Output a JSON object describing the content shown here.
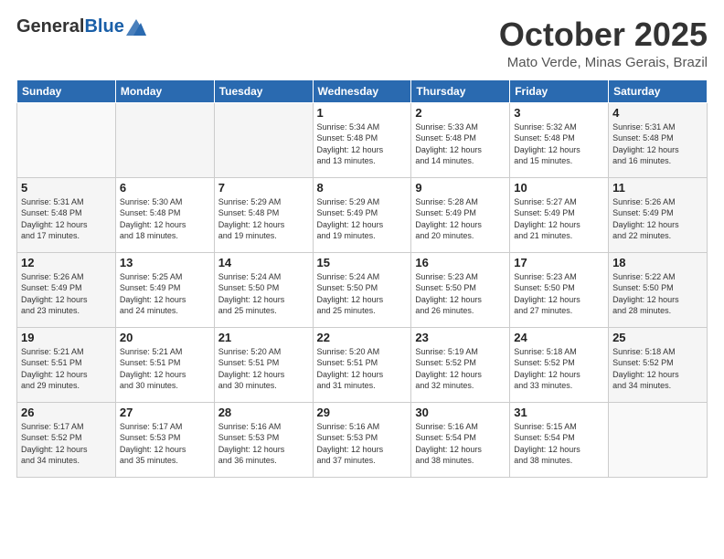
{
  "logo": {
    "general": "General",
    "blue": "Blue"
  },
  "header": {
    "month": "October 2025",
    "location": "Mato Verde, Minas Gerais, Brazil"
  },
  "weekdays": [
    "Sunday",
    "Monday",
    "Tuesday",
    "Wednesday",
    "Thursday",
    "Friday",
    "Saturday"
  ],
  "weeks": [
    [
      {
        "day": "",
        "info": ""
      },
      {
        "day": "",
        "info": ""
      },
      {
        "day": "",
        "info": ""
      },
      {
        "day": "1",
        "info": "Sunrise: 5:34 AM\nSunset: 5:48 PM\nDaylight: 12 hours\nand 13 minutes."
      },
      {
        "day": "2",
        "info": "Sunrise: 5:33 AM\nSunset: 5:48 PM\nDaylight: 12 hours\nand 14 minutes."
      },
      {
        "day": "3",
        "info": "Sunrise: 5:32 AM\nSunset: 5:48 PM\nDaylight: 12 hours\nand 15 minutes."
      },
      {
        "day": "4",
        "info": "Sunrise: 5:31 AM\nSunset: 5:48 PM\nDaylight: 12 hours\nand 16 minutes."
      }
    ],
    [
      {
        "day": "5",
        "info": "Sunrise: 5:31 AM\nSunset: 5:48 PM\nDaylight: 12 hours\nand 17 minutes."
      },
      {
        "day": "6",
        "info": "Sunrise: 5:30 AM\nSunset: 5:48 PM\nDaylight: 12 hours\nand 18 minutes."
      },
      {
        "day": "7",
        "info": "Sunrise: 5:29 AM\nSunset: 5:48 PM\nDaylight: 12 hours\nand 19 minutes."
      },
      {
        "day": "8",
        "info": "Sunrise: 5:29 AM\nSunset: 5:49 PM\nDaylight: 12 hours\nand 19 minutes."
      },
      {
        "day": "9",
        "info": "Sunrise: 5:28 AM\nSunset: 5:49 PM\nDaylight: 12 hours\nand 20 minutes."
      },
      {
        "day": "10",
        "info": "Sunrise: 5:27 AM\nSunset: 5:49 PM\nDaylight: 12 hours\nand 21 minutes."
      },
      {
        "day": "11",
        "info": "Sunrise: 5:26 AM\nSunset: 5:49 PM\nDaylight: 12 hours\nand 22 minutes."
      }
    ],
    [
      {
        "day": "12",
        "info": "Sunrise: 5:26 AM\nSunset: 5:49 PM\nDaylight: 12 hours\nand 23 minutes."
      },
      {
        "day": "13",
        "info": "Sunrise: 5:25 AM\nSunset: 5:49 PM\nDaylight: 12 hours\nand 24 minutes."
      },
      {
        "day": "14",
        "info": "Sunrise: 5:24 AM\nSunset: 5:50 PM\nDaylight: 12 hours\nand 25 minutes."
      },
      {
        "day": "15",
        "info": "Sunrise: 5:24 AM\nSunset: 5:50 PM\nDaylight: 12 hours\nand 25 minutes."
      },
      {
        "day": "16",
        "info": "Sunrise: 5:23 AM\nSunset: 5:50 PM\nDaylight: 12 hours\nand 26 minutes."
      },
      {
        "day": "17",
        "info": "Sunrise: 5:23 AM\nSunset: 5:50 PM\nDaylight: 12 hours\nand 27 minutes."
      },
      {
        "day": "18",
        "info": "Sunrise: 5:22 AM\nSunset: 5:50 PM\nDaylight: 12 hours\nand 28 minutes."
      }
    ],
    [
      {
        "day": "19",
        "info": "Sunrise: 5:21 AM\nSunset: 5:51 PM\nDaylight: 12 hours\nand 29 minutes."
      },
      {
        "day": "20",
        "info": "Sunrise: 5:21 AM\nSunset: 5:51 PM\nDaylight: 12 hours\nand 30 minutes."
      },
      {
        "day": "21",
        "info": "Sunrise: 5:20 AM\nSunset: 5:51 PM\nDaylight: 12 hours\nand 30 minutes."
      },
      {
        "day": "22",
        "info": "Sunrise: 5:20 AM\nSunset: 5:51 PM\nDaylight: 12 hours\nand 31 minutes."
      },
      {
        "day": "23",
        "info": "Sunrise: 5:19 AM\nSunset: 5:52 PM\nDaylight: 12 hours\nand 32 minutes."
      },
      {
        "day": "24",
        "info": "Sunrise: 5:18 AM\nSunset: 5:52 PM\nDaylight: 12 hours\nand 33 minutes."
      },
      {
        "day": "25",
        "info": "Sunrise: 5:18 AM\nSunset: 5:52 PM\nDaylight: 12 hours\nand 34 minutes."
      }
    ],
    [
      {
        "day": "26",
        "info": "Sunrise: 5:17 AM\nSunset: 5:52 PM\nDaylight: 12 hours\nand 34 minutes."
      },
      {
        "day": "27",
        "info": "Sunrise: 5:17 AM\nSunset: 5:53 PM\nDaylight: 12 hours\nand 35 minutes."
      },
      {
        "day": "28",
        "info": "Sunrise: 5:16 AM\nSunset: 5:53 PM\nDaylight: 12 hours\nand 36 minutes."
      },
      {
        "day": "29",
        "info": "Sunrise: 5:16 AM\nSunset: 5:53 PM\nDaylight: 12 hours\nand 37 minutes."
      },
      {
        "day": "30",
        "info": "Sunrise: 5:16 AM\nSunset: 5:54 PM\nDaylight: 12 hours\nand 38 minutes."
      },
      {
        "day": "31",
        "info": "Sunrise: 5:15 AM\nSunset: 5:54 PM\nDaylight: 12 hours\nand 38 minutes."
      },
      {
        "day": "",
        "info": ""
      }
    ]
  ]
}
